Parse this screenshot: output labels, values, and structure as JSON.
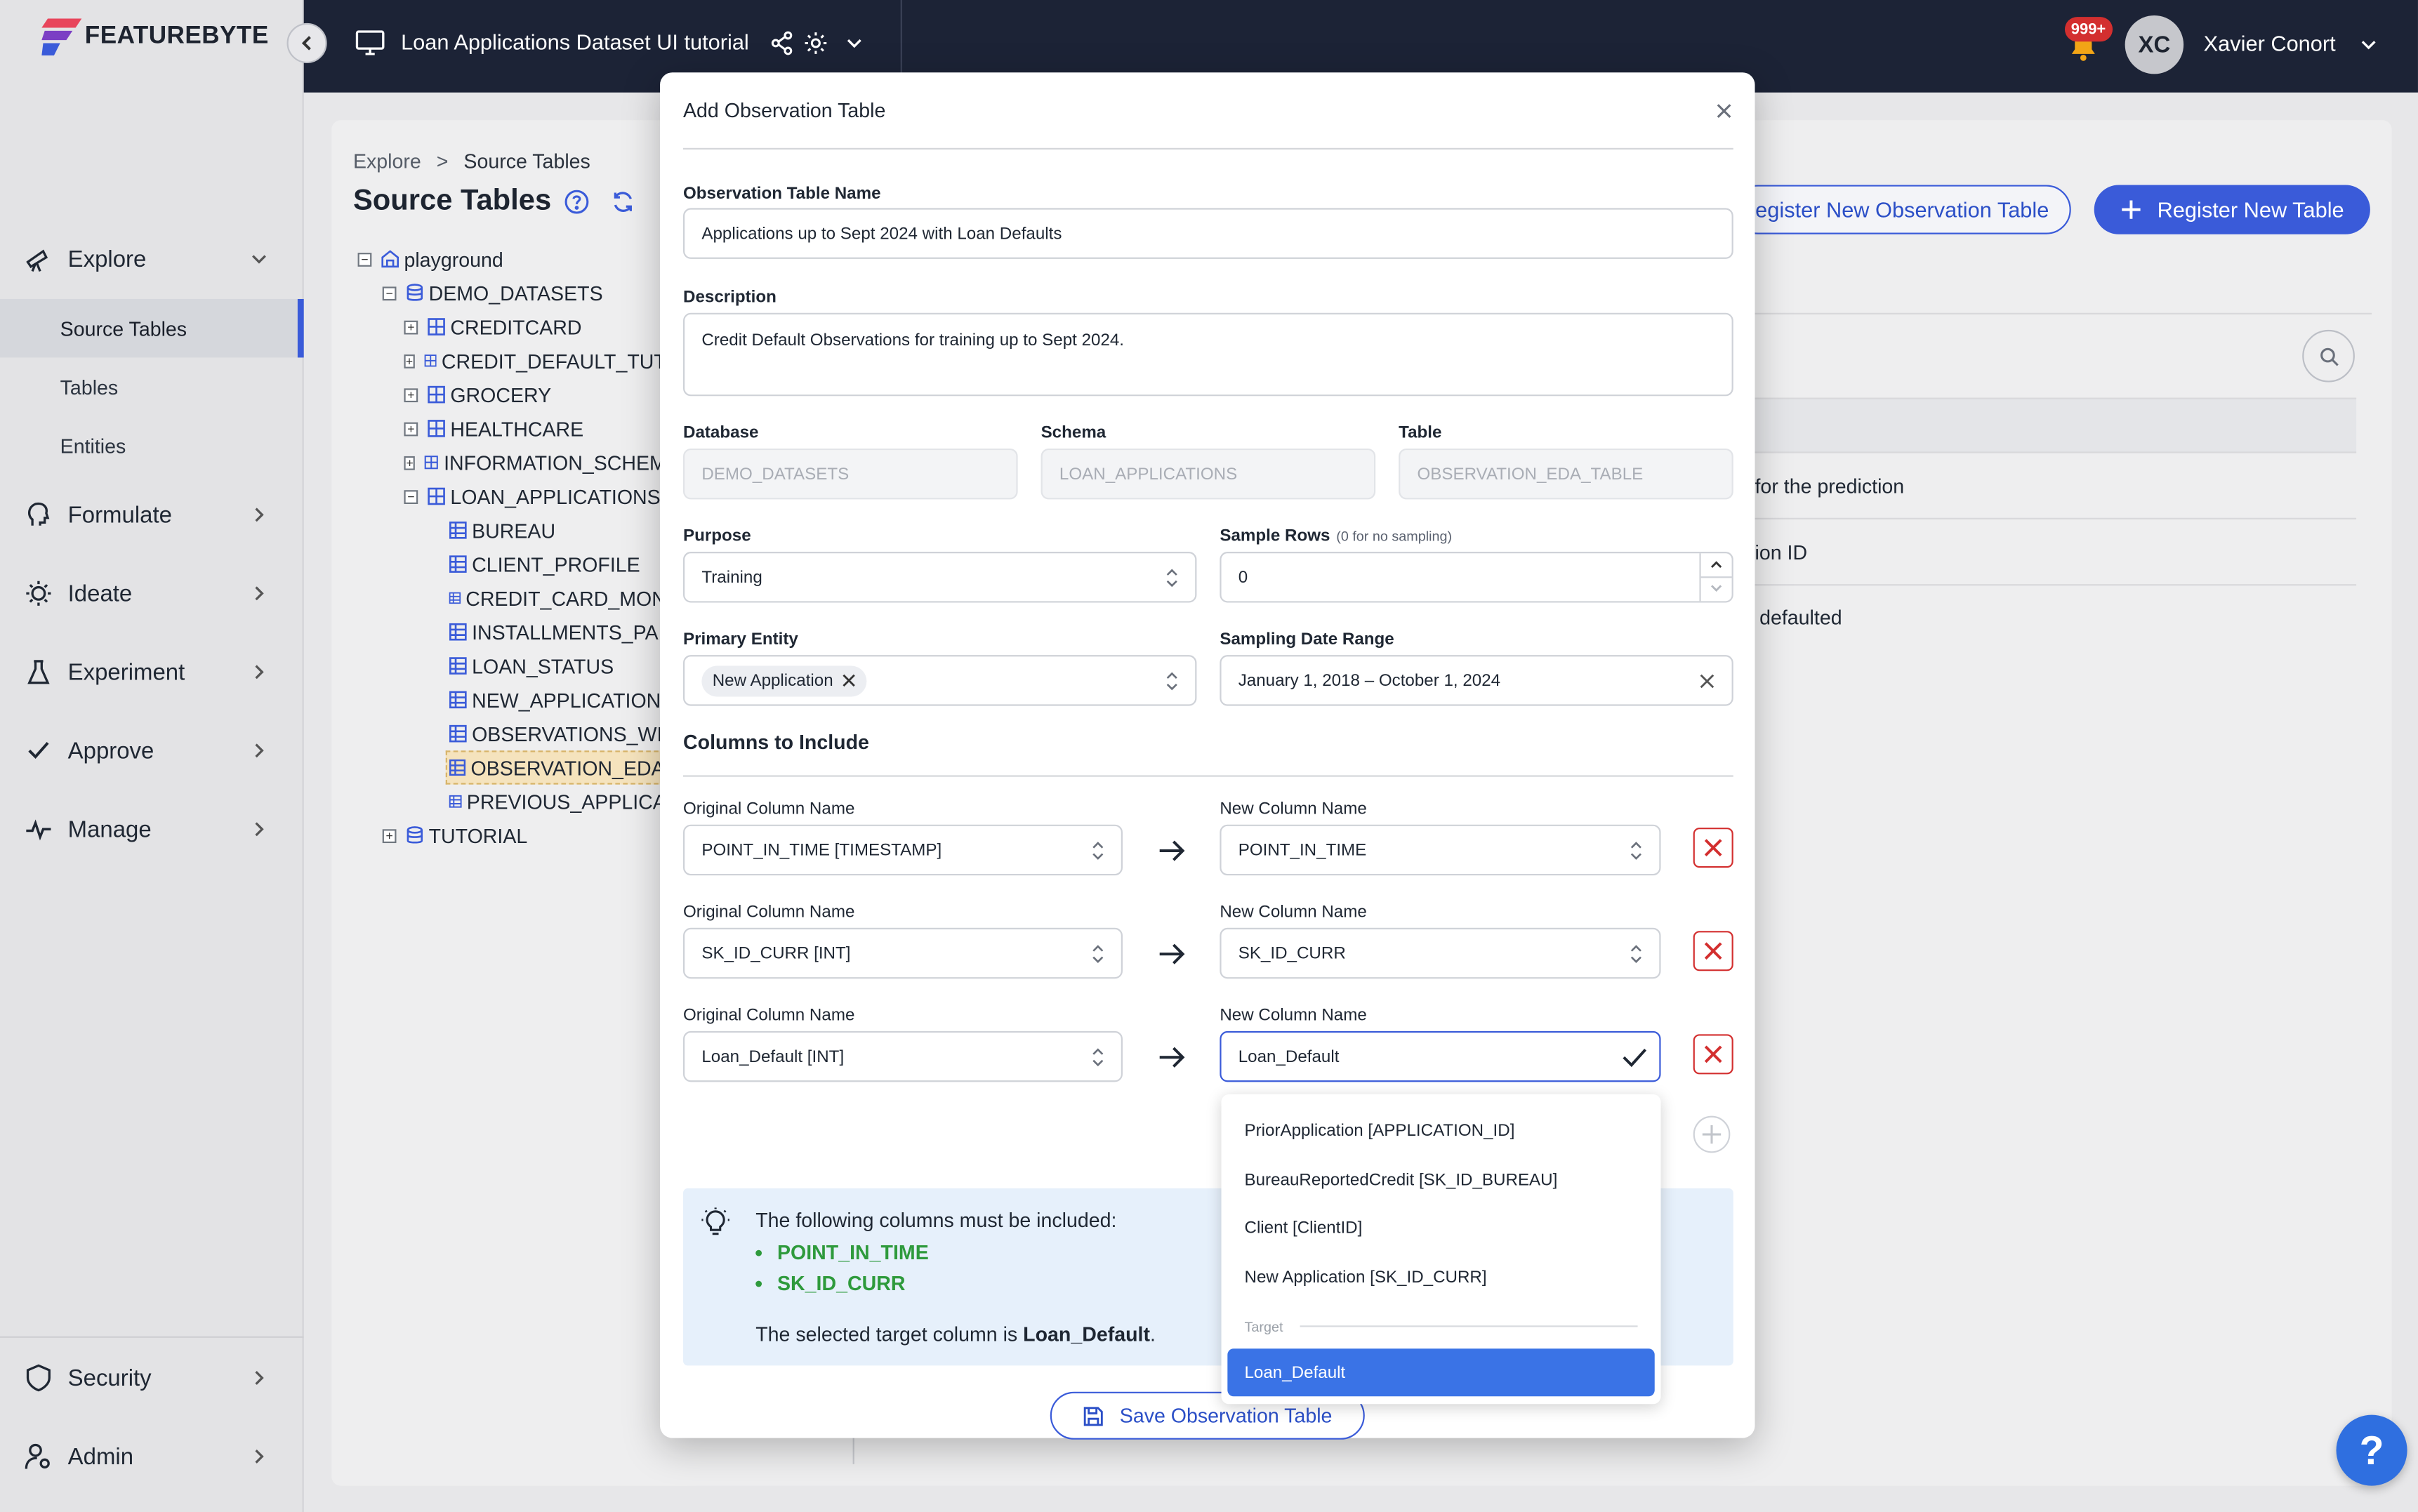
{
  "brand": {
    "logo_text": "FEATUREBYTE"
  },
  "topbar": {
    "catalog_title": "Loan Applications Dataset UI tutorial",
    "notification_count": "999+",
    "avatar_initials": "XC",
    "user_name": "Xavier Conort"
  },
  "sidebar": {
    "explore": {
      "label": "Explore",
      "items": [
        "Source Tables",
        "Tables",
        "Entities"
      ],
      "active_item": "Source Tables"
    },
    "menu": [
      "Formulate",
      "Ideate",
      "Experiment",
      "Approve",
      "Manage"
    ],
    "bottom": [
      "Security",
      "Admin"
    ]
  },
  "main": {
    "breadcrumb": {
      "root": "Explore",
      "sep": ">",
      "current": "Source Tables"
    },
    "title": "Source Tables",
    "btn_register_observation": "egister New Observation Table",
    "btn_register_table": "Register New Table",
    "right_rows": [
      "for the prediction",
      "ion ID",
      "defaulted"
    ],
    "tree": {
      "root": "playground",
      "db": "DEMO_DATASETS",
      "schemas": [
        "CREDITCARD",
        "CREDIT_DEFAULT_TUT",
        "GROCERY",
        "HEALTHCARE",
        "INFORMATION_SCHEM",
        "LOAN_APPLICATIONS"
      ],
      "loan_tables": [
        "BUREAU",
        "CLIENT_PROFILE",
        "CREDIT_CARD_MON",
        "INSTALLMENTS_PA",
        "LOAN_STATUS",
        "NEW_APPLICATION",
        "OBSERVATIONS_WI",
        "OBSERVATION_EDA",
        "PREVIOUS_APPLICA"
      ],
      "selected_table": "OBSERVATION_EDA",
      "other_db": "TUTORIAL"
    }
  },
  "modal": {
    "title": "Add Observation Table",
    "name_label": "Observation Table Name",
    "name_value": "Applications up to Sept 2024 with Loan Defaults",
    "description_label": "Description",
    "description_value": "Credit Default Observations for training up to Sept 2024.",
    "database_label": "Database",
    "database_value": "DEMO_DATASETS",
    "schema_label": "Schema",
    "schema_value": "LOAN_APPLICATIONS",
    "table_label": "Table",
    "table_value": "OBSERVATION_EDA_TABLE",
    "purpose_label": "Purpose",
    "purpose_value": "Training",
    "sample_rows_label": "Sample Rows",
    "sample_rows_hint": "(0 for no sampling)",
    "sample_rows_value": "0",
    "primary_entity_label": "Primary Entity",
    "primary_entity_chip": "New Application",
    "date_range_label": "Sampling Date Range",
    "date_range_value": "January 1, 2018 – October 1, 2024",
    "columns_title": "Columns to Include",
    "orig_col_label": "Original Column Name",
    "new_col_label": "New Column Name",
    "columns": [
      {
        "original": "POINT_IN_TIME [TIMESTAMP]",
        "new": "POINT_IN_TIME"
      },
      {
        "original": "SK_ID_CURR [INT]",
        "new": "SK_ID_CURR"
      },
      {
        "original": "Loan_Default [INT]",
        "new": "Loan_Default"
      }
    ],
    "info": {
      "heading": "The following columns must be included:",
      "required": [
        "POINT_IN_TIME",
        "SK_ID_CURR"
      ],
      "target_prefix": "The selected target column is ",
      "target_name": "Loan_Default",
      "target_suffix": "."
    },
    "save_button": "Save Observation Table"
  },
  "dropdown": {
    "options": [
      "PriorApplication [APPLICATION_ID]",
      "BureauReportedCredit [SK_ID_BUREAU]",
      "Client [ClientID]",
      "New Application [SK_ID_CURR]"
    ],
    "group_label": "Target",
    "selected": "Loan_Default"
  },
  "help_button": "?",
  "colors": {
    "primary": "#3a5bd9",
    "header_bg": "#1c2336",
    "danger": "#d32f2f",
    "success": "#2e9a3c",
    "selected_option": "#3a73e6"
  }
}
